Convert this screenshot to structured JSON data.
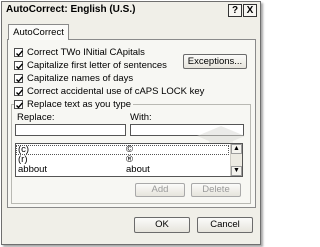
{
  "window": {
    "title": "AutoCorrect: English (U.S.)"
  },
  "titlebar_buttons": [
    {
      "label": "?"
    },
    {
      "label": "X"
    }
  ],
  "tabs": [
    {
      "label": "AutoCorrect",
      "selected": true
    }
  ],
  "options": [
    {
      "label": "Correct TWo INitial CApitals",
      "checked": true
    },
    {
      "label": "Capitalize first letter of sentences",
      "checked": true
    },
    {
      "label": "Capitalize names of days",
      "checked": true
    },
    {
      "label": "Correct accidental use of cAPS LOCK key",
      "checked": true
    },
    {
      "label": "Replace text as you type",
      "checked": true
    }
  ],
  "exceptions_button": "Exceptions...",
  "replace": {
    "label": "Replace:",
    "value": ""
  },
  "with": {
    "label": "With:",
    "value": ""
  },
  "entries": [
    {
      "replace": "(c)",
      "with": "©"
    },
    {
      "replace": "(r)",
      "with": "®"
    },
    {
      "replace": "abbout",
      "with": "about"
    }
  ],
  "add_button": "Add",
  "delete_button": "Delete",
  "ok_button": "OK",
  "cancel_button": "Cancel",
  "scroll_icons": {
    "up": "scroll-up-arrow-icon",
    "down": "scroll-down-arrow-icon"
  },
  "colors": {
    "dialog_bg": "#f0efe8",
    "panel_bg": "#f7f7f3",
    "border": "#8a8a8a"
  }
}
